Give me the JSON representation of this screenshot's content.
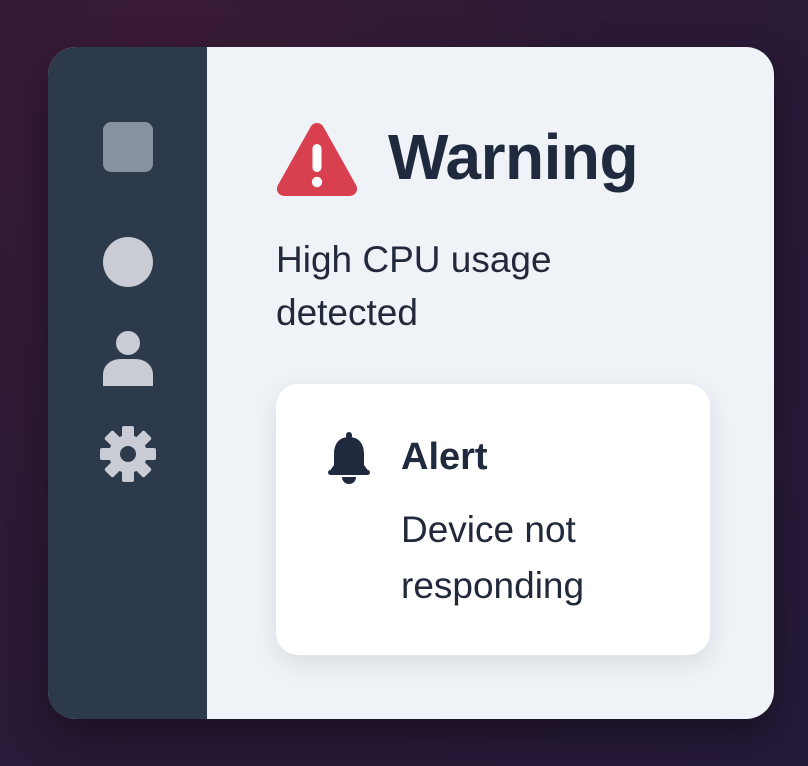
{
  "sidebar": {
    "items": [
      {
        "icon": "square-icon"
      },
      {
        "icon": "circle-icon"
      },
      {
        "icon": "user-icon"
      },
      {
        "icon": "gear-icon"
      }
    ]
  },
  "warning": {
    "icon": "warning-triangle-icon",
    "title": "Warning",
    "message": "High CPU usage detected"
  },
  "alert": {
    "icon": "bell-icon",
    "title": "Alert",
    "message": "Device not responding"
  },
  "colors": {
    "background": "#2c1a36",
    "sidebar": "#2c3a4b",
    "panel": "#eff2f6",
    "card": "#ffffff",
    "warning_red": "#d9404f",
    "text_dark": "#1f2a3f"
  }
}
